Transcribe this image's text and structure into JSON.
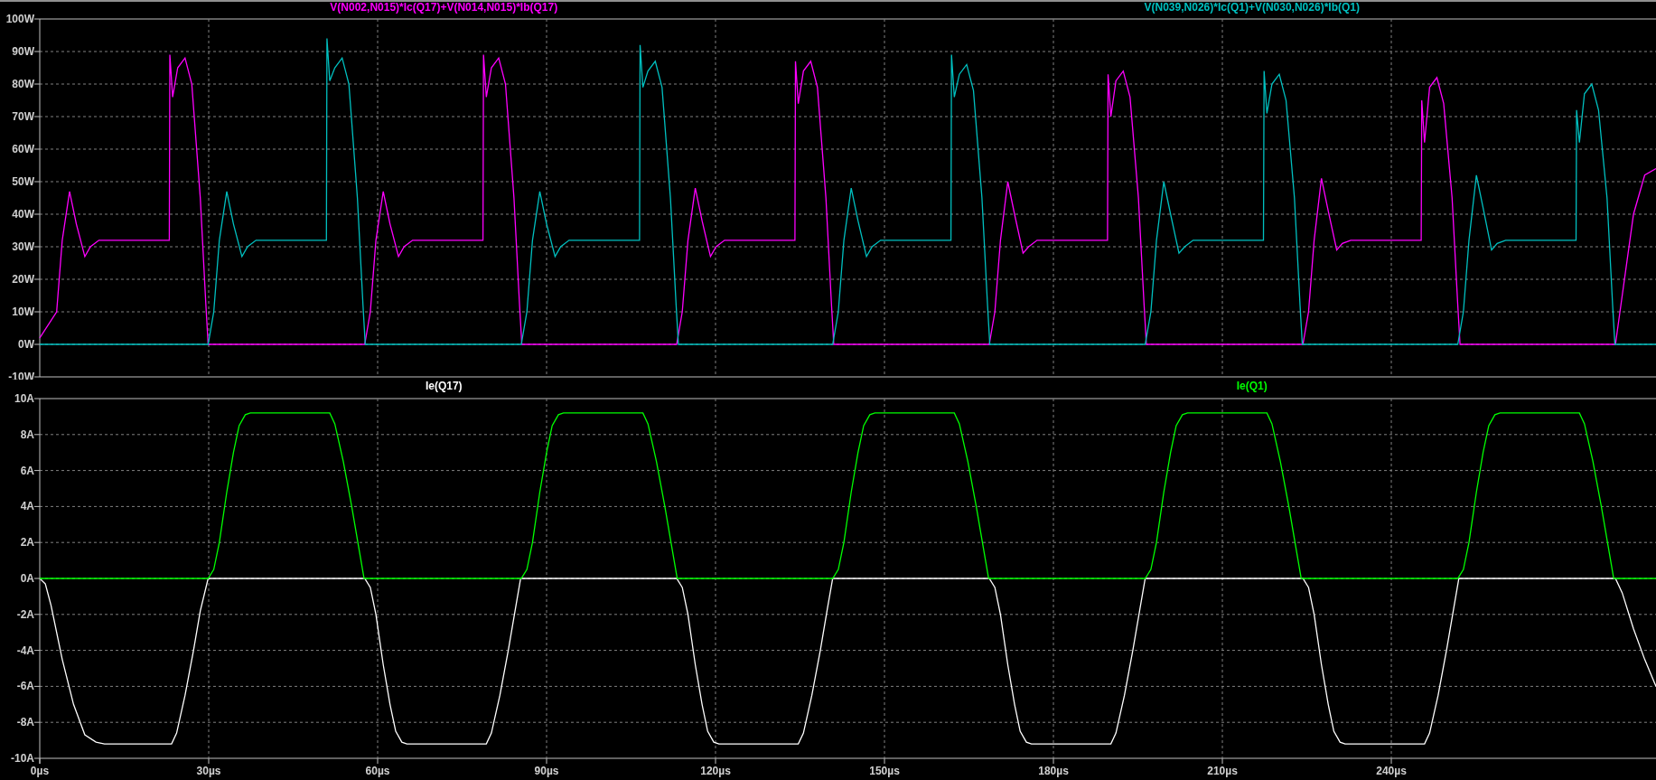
{
  "panes": [
    {
      "chart_data": {
        "type": "line",
        "grid": true,
        "xlim": [
          0,
          287
        ],
        "ylim": [
          -10,
          100
        ],
        "yticks": [
          {
            "value": -10,
            "label": "-10W"
          },
          {
            "value": 0,
            "label": "0W"
          },
          {
            "value": 10,
            "label": "10W"
          },
          {
            "value": 20,
            "label": "20W"
          },
          {
            "value": 30,
            "label": "30W"
          },
          {
            "value": 40,
            "label": "40W"
          },
          {
            "value": 50,
            "label": "50W"
          },
          {
            "value": 60,
            "label": "60W"
          },
          {
            "value": 70,
            "label": "70W"
          },
          {
            "value": 80,
            "label": "80W"
          },
          {
            "value": 90,
            "label": "90W"
          },
          {
            "value": 100,
            "label": "100W"
          }
        ],
        "series": [
          {
            "name": "V(N002,N015)*Ic(Q17)+V(N014,N015)*Ib(Q17)",
            "color": "#ff00ff",
            "x": [
              0,
              3,
              4,
              5.3,
              6.5,
              8,
              9,
              10.5,
              23,
              23.1,
              23.6,
              24.5,
              25.8,
              27,
              28.5,
              29.5,
              29.9,
              57.7,
              58.7,
              59.7,
              61,
              62.2,
              63.7,
              64.7,
              66.2,
              78.7,
              78.8,
              79.3,
              80.2,
              81.5,
              82.7,
              84.2,
              85.2,
              85.6,
              113.1,
              114.1,
              115.1,
              116.4,
              117.6,
              119.1,
              120.1,
              121.6,
              134.1,
              134.2,
              134.7,
              135.6,
              136.9,
              138.1,
              139.6,
              140.6,
              141,
              168.6,
              169.6,
              170.6,
              171.9,
              173.1,
              174.6,
              175.6,
              177.1,
              189.6,
              189.7,
              190.2,
              191.1,
              192.4,
              193.6,
              195.1,
              196.1,
              196.5,
              224.3,
              225.3,
              226.3,
              227.6,
              228.8,
              230.3,
              231.3,
              232.8,
              245.3,
              245.4,
              245.9,
              246.8,
              248.1,
              249.3,
              250.8,
              251.8,
              252.2,
              279.8,
              281,
              283,
              285,
              287
            ],
            "values": [
              2,
              10,
              32,
              47,
              37,
              27,
              30,
              32,
              32,
              89,
              76,
              85,
              88,
              80,
              45,
              12,
              0,
              0,
              10,
              32,
              47,
              37,
              27,
              30,
              32,
              32,
              89,
              76,
              85,
              88,
              80,
              45,
              12,
              0,
              0,
              10,
              32,
              48,
              38,
              27,
              30,
              32,
              32,
              87,
              74,
              84,
              87,
              79,
              45,
              12,
              0,
              0,
              10,
              32,
              50,
              40,
              28,
              30,
              32,
              32,
              83,
              70,
              81,
              84,
              76,
              45,
              12,
              0,
              0,
              10,
              32,
              51,
              41,
              29,
              31,
              32,
              32,
              75,
              62,
              79,
              82,
              74,
              45,
              12,
              0,
              0,
              15,
              40,
              52,
              54
            ]
          },
          {
            "name": "V(N039,N026)*Ic(Q1)+V(N030,N026)*Ib(Q1)",
            "color": "#00c0c0",
            "x": [
              0,
              29.9,
              30.9,
              31.9,
              33.2,
              34.4,
              35.9,
              36.9,
              38.4,
              50.9,
              51,
              51.5,
              52.4,
              53.7,
              54.9,
              56.4,
              57.4,
              57.8,
              85.5,
              86.5,
              87.5,
              88.8,
              90,
              91.5,
              92.5,
              94,
              106.5,
              106.6,
              107.1,
              108,
              109.3,
              110.5,
              112,
              113,
              113.4,
              140.8,
              141.8,
              142.8,
              144.1,
              145.3,
              146.8,
              147.8,
              149.3,
              161.8,
              161.9,
              162.4,
              163.3,
              164.6,
              165.8,
              167.3,
              168.3,
              168.7,
              196.3,
              197.3,
              198.3,
              199.6,
              200.8,
              202.3,
              203.3,
              204.8,
              217.3,
              217.4,
              217.9,
              218.8,
              220.1,
              221.3,
              222.8,
              223.8,
              224.2,
              251.8,
              252.8,
              253.8,
              255.1,
              256.3,
              257.8,
              258.8,
              260.3,
              272.8,
              272.9,
              273.4,
              274.3,
              275.6,
              276.8,
              278.3,
              279.3,
              279.7,
              287
            ],
            "values": [
              0,
              0,
              10,
              32,
              47,
              37,
              27,
              30,
              32,
              32,
              94,
              81,
              85,
              88,
              80,
              45,
              12,
              0,
              0,
              10,
              32,
              47,
              37,
              27,
              30,
              32,
              32,
              92,
              79,
              84,
              87,
              79,
              45,
              12,
              0,
              0,
              10,
              32,
              48,
              38,
              27,
              30,
              32,
              32,
              89,
              76,
              83,
              86,
              78,
              45,
              12,
              0,
              0,
              10,
              32,
              50,
              40,
              28,
              30,
              32,
              32,
              84,
              71,
              80,
              83,
              75,
              45,
              12,
              0,
              0,
              10,
              32,
              52,
              42,
              29,
              31,
              32,
              32,
              72,
              62,
              77,
              80,
              72,
              45,
              12,
              0,
              0
            ]
          }
        ]
      }
    },
    {
      "chart_data": {
        "type": "line",
        "grid": true,
        "xlim": [
          0,
          287
        ],
        "ylim": [
          -10,
          10
        ],
        "xticks": [
          {
            "value": 0,
            "label": "0µs"
          },
          {
            "value": 30,
            "label": "30µs"
          },
          {
            "value": 60,
            "label": "60µs"
          },
          {
            "value": 90,
            "label": "90µs"
          },
          {
            "value": 120,
            "label": "120µs"
          },
          {
            "value": 150,
            "label": "150µs"
          },
          {
            "value": 180,
            "label": "180µs"
          },
          {
            "value": 210,
            "label": "210µs"
          },
          {
            "value": 240,
            "label": "240µs"
          }
        ],
        "yticks": [
          {
            "value": -10,
            "label": "-10A"
          },
          {
            "value": -8,
            "label": "-8A"
          },
          {
            "value": -6,
            "label": "-6A"
          },
          {
            "value": -4,
            "label": "-4A"
          },
          {
            "value": -2,
            "label": "-2A"
          },
          {
            "value": 0,
            "label": "0A"
          },
          {
            "value": 2,
            "label": "2A"
          },
          {
            "value": 4,
            "label": "4A"
          },
          {
            "value": 6,
            "label": "6A"
          },
          {
            "value": 8,
            "label": "8A"
          },
          {
            "value": 10,
            "label": "10A"
          }
        ],
        "series": [
          {
            "name": "Ie(Q17)",
            "color": "#ffffff",
            "x": [
              0,
              1,
              2,
              4,
              6,
              8,
              10,
              11.5,
              23.4,
              24.3,
              25.8,
              27.3,
              28.5,
              29.9,
              57.7,
              58.7,
              59.7,
              61,
              62.2,
              63.2,
              64.3,
              65.2,
              79.3,
              80.2,
              81.7,
              83.2,
              84.4,
              85.4,
              113.1,
              114.1,
              115.1,
              116.4,
              117.6,
              118.6,
              119.7,
              120.6,
              134.7,
              135.6,
              137.1,
              138.6,
              139.8,
              140.8,
              168.6,
              169.6,
              170.6,
              171.9,
              173.1,
              174.1,
              175.2,
              176.1,
              190.2,
              191.1,
              192.6,
              194.1,
              195.3,
              196.3,
              224.3,
              225.3,
              226.3,
              227.6,
              228.8,
              229.8,
              230.9,
              231.8,
              245.9,
              246.8,
              248.3,
              249.8,
              251,
              252,
              279.8,
              281,
              283,
              285,
              287
            ],
            "values": [
              0,
              -0.3,
              -1.5,
              -4.5,
              -7,
              -8.7,
              -9.1,
              -9.2,
              -9.2,
              -8.6,
              -6.5,
              -4,
              -1.8,
              0,
              0,
              -0.5,
              -2,
              -4.8,
              -7,
              -8.5,
              -9.1,
              -9.2,
              -9.2,
              -8.6,
              -6.5,
              -4,
              -1.8,
              0,
              0,
              -0.5,
              -2,
              -4.8,
              -7,
              -8.5,
              -9.1,
              -9.2,
              -9.2,
              -8.6,
              -6.5,
              -4,
              -1.8,
              0,
              0,
              -0.5,
              -2,
              -4.8,
              -7,
              -8.5,
              -9.1,
              -9.2,
              -9.2,
              -8.6,
              -6.5,
              -4,
              -1.8,
              0,
              0,
              -0.5,
              -2,
              -4.8,
              -7,
              -8.5,
              -9.1,
              -9.2,
              -9.2,
              -8.6,
              -6.5,
              -4,
              -1.8,
              0,
              0,
              -0.8,
              -2.8,
              -4.5,
              -6
            ]
          },
          {
            "name": "Ie(Q1)",
            "color": "#00ff00",
            "x": [
              0,
              29.9,
              30.9,
              31.9,
              33.2,
              34.4,
              35.4,
              36.5,
              37.4,
              51.5,
              52.4,
              53.9,
              55.4,
              56.6,
              57.6,
              85.5,
              86.5,
              87.5,
              88.8,
              90,
              91,
              92.1,
              93,
              107.1,
              108,
              109.5,
              111,
              112.2,
              113.2,
              140.8,
              141.8,
              142.8,
              144.1,
              145.3,
              146.3,
              147.4,
              148.3,
              162.4,
              163.3,
              164.8,
              166.3,
              167.5,
              168.5,
              196.3,
              197.3,
              198.3,
              199.6,
              200.8,
              201.8,
              202.9,
              203.8,
              217.9,
              218.8,
              220.3,
              221.8,
              223,
              224,
              251.8,
              252.8,
              253.8,
              255.1,
              256.3,
              257.3,
              258.4,
              259.3,
              273.4,
              274.3,
              275.8,
              277.3,
              278.5,
              279.5,
              287
            ],
            "values": [
              0,
              0,
              0.5,
              2,
              4.8,
              7,
              8.5,
              9.1,
              9.2,
              9.2,
              8.6,
              6.5,
              4,
              1.8,
              0,
              0,
              0.5,
              2,
              4.8,
              7,
              8.5,
              9.1,
              9.2,
              9.2,
              8.6,
              6.5,
              4,
              1.8,
              0,
              0,
              0.5,
              2,
              4.8,
              7,
              8.5,
              9.1,
              9.2,
              9.2,
              8.6,
              6.5,
              4,
              1.8,
              0,
              0,
              0.5,
              2,
              4.8,
              7,
              8.5,
              9.1,
              9.2,
              9.2,
              8.6,
              6.5,
              4,
              1.8,
              0,
              0,
              0.5,
              2,
              4.8,
              7,
              8.5,
              9.1,
              9.2,
              9.2,
              8.6,
              6.5,
              4,
              1.8,
              0,
              0
            ]
          }
        ]
      }
    }
  ]
}
